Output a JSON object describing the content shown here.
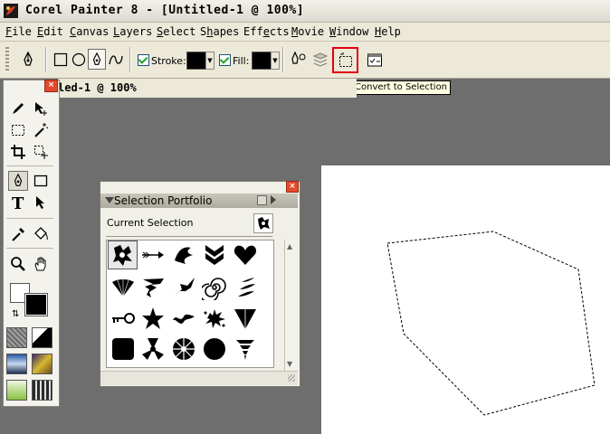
{
  "window": {
    "title": "Corel Painter 8 - [Untitled-1 @ 100%]"
  },
  "menu": {
    "items": [
      {
        "pre": "",
        "u": "F",
        "post": "ile"
      },
      {
        "pre": "",
        "u": "E",
        "post": "dit"
      },
      {
        "pre": "",
        "u": "C",
        "post": "anvas"
      },
      {
        "pre": "",
        "u": "L",
        "post": "ayers"
      },
      {
        "pre": "",
        "u": "S",
        "post": "elect"
      },
      {
        "pre": "S",
        "u": "h",
        "post": "apes"
      },
      {
        "pre": "Eff",
        "u": "e",
        "post": "cts"
      },
      {
        "pre": "",
        "u": "M",
        "post": "ovie"
      },
      {
        "pre": "",
        "u": "W",
        "post": "indow"
      },
      {
        "pre": "",
        "u": "H",
        "post": "elp"
      }
    ]
  },
  "propbar": {
    "stroke_label": "Stroke:",
    "fill_label": "Fill:",
    "stroke_color": "#000000",
    "fill_color": "#000000",
    "stroke_checked": true,
    "fill_checked": true
  },
  "tooltip": {
    "text": "Convert to Selection"
  },
  "document": {
    "title_visible": "led-1 @ 100%"
  },
  "palette": {
    "title": "Selection Portfolio",
    "current_label": "Current Selection",
    "shapes": [
      [
        "splat-icon",
        "arrow-icon",
        "bird-icon",
        "chevrons-icon",
        "heart-icon"
      ],
      [
        "fan-icon",
        "tornado-icon",
        "diving-bird-icon",
        "spiral-icon",
        "feathers-icon"
      ],
      [
        "key-icon",
        "star-icon",
        "squiggle-icon",
        "ink-blot-icon",
        "triangle-down-icon"
      ],
      [
        "rounded-square-icon",
        "trefoil-icon",
        "sliced-circle-icon",
        "circle-icon",
        "drill-icon"
      ]
    ]
  },
  "colors": {
    "highlight": "#e3000f",
    "workspace": "#6e6e6e",
    "canvas": "#ffffff"
  }
}
